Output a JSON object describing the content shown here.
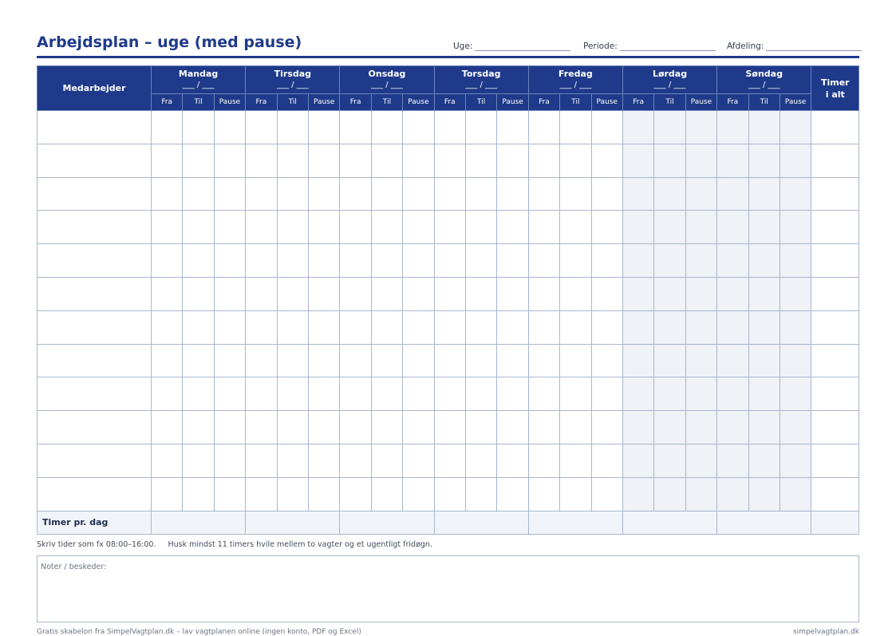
{
  "title": "Arbejdsplan – uge (med pause)",
  "fields": {
    "week_label": "Uge:",
    "period_label": "Periode:",
    "department_label": "Afdeling:"
  },
  "table": {
    "employee_header": "Medarbejder",
    "date_placeholder": "___ / ___",
    "days": [
      {
        "name": "Mandag",
        "weekend": false
      },
      {
        "name": "Tirsdag",
        "weekend": false
      },
      {
        "name": "Onsdag",
        "weekend": false
      },
      {
        "name": "Torsdag",
        "weekend": false
      },
      {
        "name": "Fredag",
        "weekend": false
      },
      {
        "name": "Lørdag",
        "weekend": true
      },
      {
        "name": "Søndag",
        "weekend": true
      }
    ],
    "subcolumns": [
      "Fra",
      "Til",
      "Pause"
    ],
    "total_header_line1": "Timer",
    "total_header_line2": "i alt",
    "row_count": 12,
    "footer_label": "Timer pr. dag"
  },
  "instructions": {
    "line1": "Skriv tider som fx 08:00–16:00.",
    "line2": "Husk mindst 11 timers hvile mellem to vagter og et ugentligt fridøgn."
  },
  "notes_label": "Noter / beskeder:",
  "footer": {
    "left": "Gratis skabelon fra SimpelVagtplan.dk – lav vagtplanen online (ingen konto, PDF og Excel)",
    "right": "simpelvagtplan.dk"
  },
  "colors": {
    "primary": "#1f3a8a",
    "grid": "#a9b6cd",
    "weekend_fill": "#eff2f7"
  }
}
